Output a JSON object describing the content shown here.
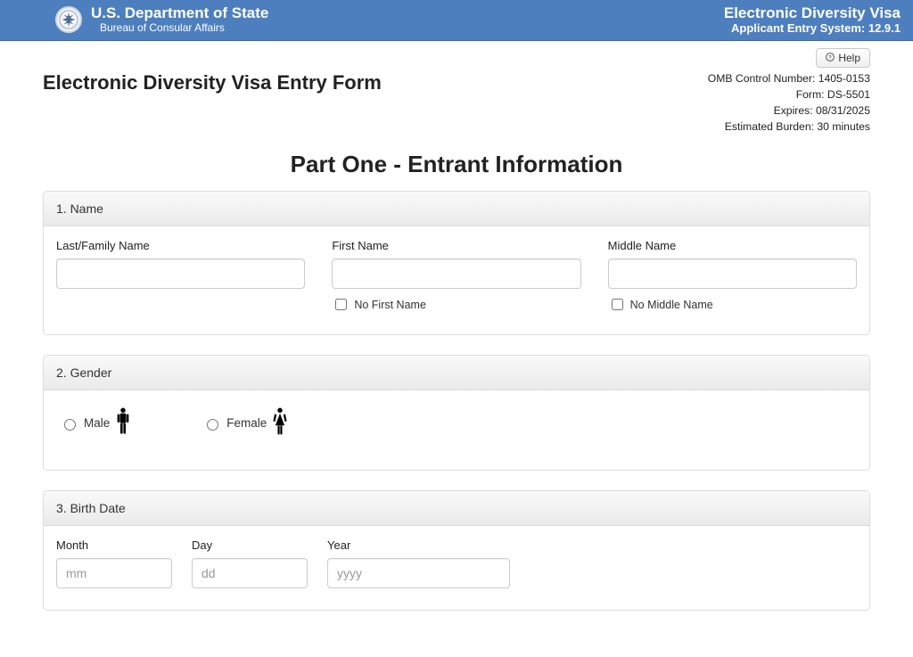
{
  "header": {
    "dept_title": "U.S. Department of State",
    "dept_sub": "Bureau of Consular Affairs",
    "sys_title": "Electronic Diversity Visa",
    "sys_sub": "Applicant Entry System: 12.9.1"
  },
  "help": {
    "label": "Help"
  },
  "page_title": "Electronic Diversity Visa Entry Form",
  "meta": {
    "omb": "OMB Control Number: 1405-0153",
    "form": "Form: DS-5501",
    "expires": "Expires: 08/31/2025",
    "burden": "Estimated Burden: 30 minutes"
  },
  "section_heading": "Part One - Entrant Information",
  "panel1": {
    "title": "1. Name",
    "last_label": "Last/Family Name",
    "first_label": "First Name",
    "middle_label": "Middle Name",
    "no_first_label": "No First Name",
    "no_middle_label": "No Middle Name",
    "last_value": "",
    "first_value": "",
    "middle_value": ""
  },
  "panel2": {
    "title": "2. Gender",
    "male_label": "Male",
    "female_label": "Female"
  },
  "panel3": {
    "title": "3. Birth Date",
    "month_label": "Month",
    "day_label": "Day",
    "year_label": "Year",
    "month_placeholder": "mm",
    "day_placeholder": "dd",
    "year_placeholder": "yyyy",
    "month_value": "",
    "day_value": "",
    "year_value": ""
  }
}
